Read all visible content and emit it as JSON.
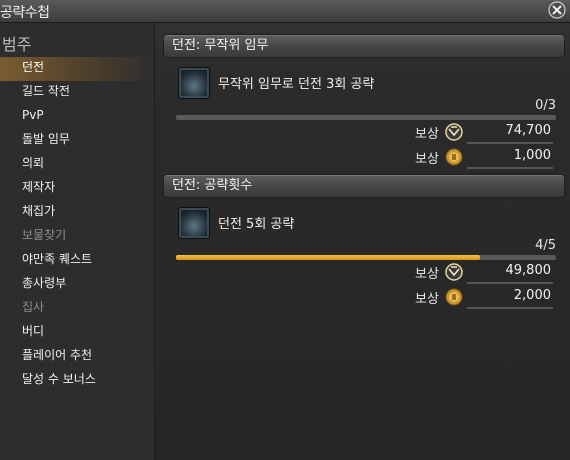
{
  "window": {
    "title": "공략수첩"
  },
  "sidebar": {
    "category_title": "범주",
    "items": [
      {
        "label": "던전",
        "state": "selected"
      },
      {
        "label": "길드 작전",
        "state": "normal"
      },
      {
        "label": "PvP",
        "state": "normal"
      },
      {
        "label": "돌발 임무",
        "state": "normal"
      },
      {
        "label": "의뢰",
        "state": "normal"
      },
      {
        "label": "제작자",
        "state": "normal"
      },
      {
        "label": "채집가",
        "state": "normal"
      },
      {
        "label": "보물찾기",
        "state": "disabled"
      },
      {
        "label": "야만족 퀘스트",
        "state": "normal"
      },
      {
        "label": "총사령부",
        "state": "normal"
      },
      {
        "label": "집사",
        "state": "disabled"
      },
      {
        "label": "버디",
        "state": "normal"
      },
      {
        "label": "플레이어 추천",
        "state": "normal"
      },
      {
        "label": "달성 수 보너스",
        "state": "normal"
      }
    ]
  },
  "sections": [
    {
      "header": "던전: 무작위 임무",
      "quest": "무작위 임무로 던전 3회 공략",
      "progress_text": "0/3",
      "progress_fraction": 0.0,
      "rewards": [
        {
          "label": "보상",
          "icon": "seal-icon",
          "amount": "74,700"
        },
        {
          "label": "보상",
          "icon": "gil-coin-icon",
          "amount": "1,000"
        }
      ]
    },
    {
      "header": "던전: 공략횟수",
      "quest": "던전 5회 공략",
      "progress_text": "4/5",
      "progress_fraction": 0.8,
      "rewards": [
        {
          "label": "보상",
          "icon": "seal-icon",
          "amount": "49,800"
        },
        {
          "label": "보상",
          "icon": "gil-coin-icon",
          "amount": "2,000"
        }
      ]
    }
  ],
  "colors": {
    "progress_fill": "#f0b630",
    "selected_item": "#7a5c32",
    "track": "#595959"
  }
}
